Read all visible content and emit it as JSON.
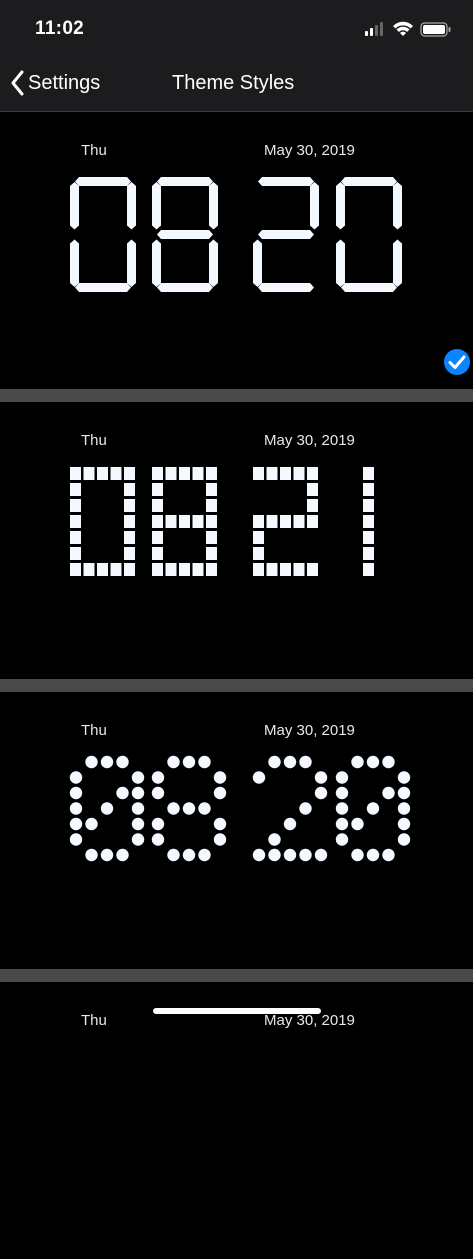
{
  "status_bar": {
    "time": "11:02",
    "icons": [
      "cellular-signal-icon",
      "wifi-icon",
      "battery-icon"
    ]
  },
  "nav": {
    "back_label": "Settings",
    "title": "Theme Styles"
  },
  "themes": [
    {
      "style": "seven-segment",
      "day": "Thu",
      "date": "May 30, 2019",
      "time": "0820",
      "selected": true
    },
    {
      "style": "square-dot-matrix",
      "day": "Thu",
      "date": "May 30, 2019",
      "time": "0821",
      "selected": false
    },
    {
      "style": "round-dot-matrix",
      "day": "Thu",
      "date": "May 30, 2019",
      "time": "0820",
      "selected": false
    },
    {
      "style": "unknown",
      "day": "Thu",
      "date": "May 30, 2019",
      "time": "",
      "selected": false
    }
  ],
  "colors": {
    "background": "#000000",
    "bars": "#1c1c1e",
    "separator": "#4a4a4a",
    "digits": "#f4f9ff",
    "accent": "#0a84ff"
  }
}
